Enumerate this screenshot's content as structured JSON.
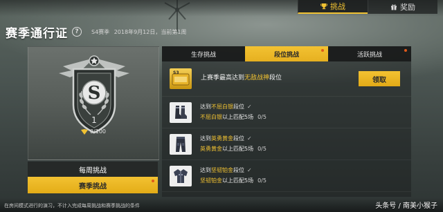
{
  "top_tabs": [
    {
      "label": "挑战",
      "icon": "trophy-icon",
      "active": true
    },
    {
      "label": "奖励",
      "icon": "gift-icon",
      "active": false
    }
  ],
  "header": {
    "title": "赛季通行证",
    "season_label": "S4赛季",
    "date_text": "2018年9月12日，当前第1周"
  },
  "emblem": {
    "letter": "S",
    "level": "1",
    "points": "0/100"
  },
  "left_buttons": {
    "weekly": "每周挑战",
    "season": "赛季挑战"
  },
  "subtabs": [
    {
      "label": "生存挑战",
      "active": false,
      "dot": false
    },
    {
      "label": "段位挑战",
      "active": true,
      "dot": true
    },
    {
      "label": "活跃挑战",
      "active": false,
      "dot": true
    }
  ],
  "reward_task": {
    "badge": "S3",
    "text_prefix": "上赛季最高达到",
    "text_highlight": "无敌战神",
    "text_suffix": "段位",
    "button": "领取"
  },
  "tasks": [
    {
      "line1_prefix": "达到",
      "line1_highlight": "不屈白银",
      "line1_suffix": "段位",
      "line2_highlight": "不屈白银",
      "line2_suffix": "以上匹配5场",
      "progress": "0/5",
      "icon": "boots-icon"
    },
    {
      "line1_prefix": "达到",
      "line1_highlight": "英勇黄金",
      "line1_suffix": "段位",
      "line2_highlight": "英勇黄金",
      "line2_suffix": "以上匹配5场",
      "progress": "0/5",
      "icon": "pants-icon"
    },
    {
      "line1_prefix": "达到",
      "line1_highlight": "坚韧铂金",
      "line1_suffix": "段位",
      "line2_highlight": "坚韧铂金",
      "line2_suffix": "以上匹配5场",
      "progress": "0/5",
      "icon": "jacket-icon"
    }
  ],
  "footer": {
    "note": "在房间模式进行的演习，不计入完成每周挑战和赛季挑战的条件",
    "watermark": "头条号 / 南美小猴子"
  },
  "colors": {
    "accent": "#f1c232",
    "notify_dot": "#e05a1a"
  }
}
